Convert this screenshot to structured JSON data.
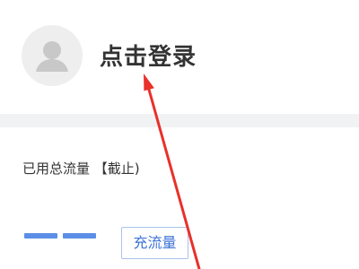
{
  "header": {
    "login_label": "点击登录",
    "avatar_icon": "user-silhouette-icon"
  },
  "usage": {
    "label": "已用总流量 【截止)",
    "value_placeholder": "— —",
    "recharge_label": "充流量"
  },
  "colors": {
    "accent": "#3d73d6",
    "dash": "#5b8ee6",
    "annotation_arrow": "#e8312a",
    "divider": "#f1f2f4"
  },
  "annotation": {
    "type": "arrow",
    "points_to": "login_label"
  }
}
